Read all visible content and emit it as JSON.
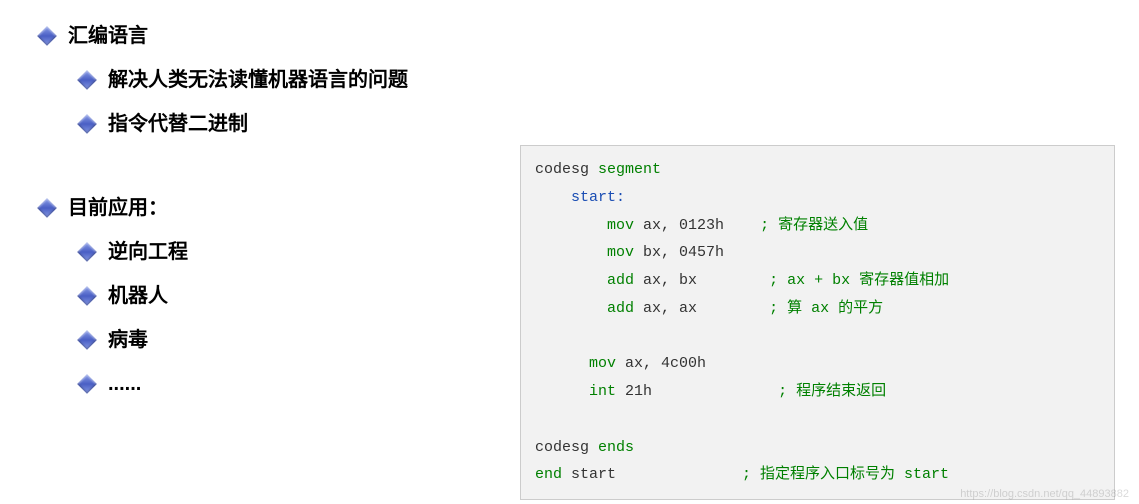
{
  "outline": {
    "sections": [
      {
        "title": "汇编语言",
        "items": [
          "解决人类无法读懂机器语言的问题",
          "指令代替二进制"
        ]
      },
      {
        "title": "目前应用：",
        "items": [
          "逆向工程",
          "机器人",
          "病毒",
          "......"
        ]
      }
    ]
  },
  "code": {
    "lines": [
      {
        "parts": [
          {
            "t": "codesg ",
            "c": ""
          },
          {
            "t": "segment",
            "c": "kw-green"
          }
        ]
      },
      {
        "parts": [
          {
            "t": "    start:",
            "c": "kw-blue"
          }
        ]
      },
      {
        "parts": [
          {
            "t": "        ",
            "c": ""
          },
          {
            "t": "mov",
            "c": "kw-green"
          },
          {
            "t": " ax, 0123h    ",
            "c": ""
          },
          {
            "t": "; 寄存器送入值",
            "c": "comment"
          }
        ]
      },
      {
        "parts": [
          {
            "t": "        ",
            "c": ""
          },
          {
            "t": "mov",
            "c": "kw-green"
          },
          {
            "t": " bx, 0457h",
            "c": ""
          }
        ]
      },
      {
        "parts": [
          {
            "t": "        ",
            "c": ""
          },
          {
            "t": "add",
            "c": "kw-green"
          },
          {
            "t": " ax, bx        ",
            "c": ""
          },
          {
            "t": "; ax + bx 寄存器值相加",
            "c": "comment"
          }
        ]
      },
      {
        "parts": [
          {
            "t": "        ",
            "c": ""
          },
          {
            "t": "add",
            "c": "kw-green"
          },
          {
            "t": " ax, ax        ",
            "c": ""
          },
          {
            "t": "; 算 ax 的平方",
            "c": "comment"
          }
        ]
      },
      {
        "parts": [
          {
            "t": "",
            "c": ""
          }
        ]
      },
      {
        "parts": [
          {
            "t": "      ",
            "c": ""
          },
          {
            "t": "mov",
            "c": "kw-green"
          },
          {
            "t": " ax, 4c00h",
            "c": ""
          }
        ]
      },
      {
        "parts": [
          {
            "t": "      ",
            "c": ""
          },
          {
            "t": "int",
            "c": "kw-green"
          },
          {
            "t": " 21h              ",
            "c": ""
          },
          {
            "t": "; 程序结束返回",
            "c": "comment"
          }
        ]
      },
      {
        "parts": [
          {
            "t": "",
            "c": ""
          }
        ]
      },
      {
        "parts": [
          {
            "t": "codesg ",
            "c": ""
          },
          {
            "t": "ends",
            "c": "kw-green"
          }
        ]
      },
      {
        "parts": [
          {
            "t": "end",
            "c": "kw-green"
          },
          {
            "t": " start              ",
            "c": ""
          },
          {
            "t": "; 指定程序入口标号为 start",
            "c": "comment"
          }
        ]
      }
    ]
  },
  "watermark": "https://blog.csdn.net/qq_44893882"
}
